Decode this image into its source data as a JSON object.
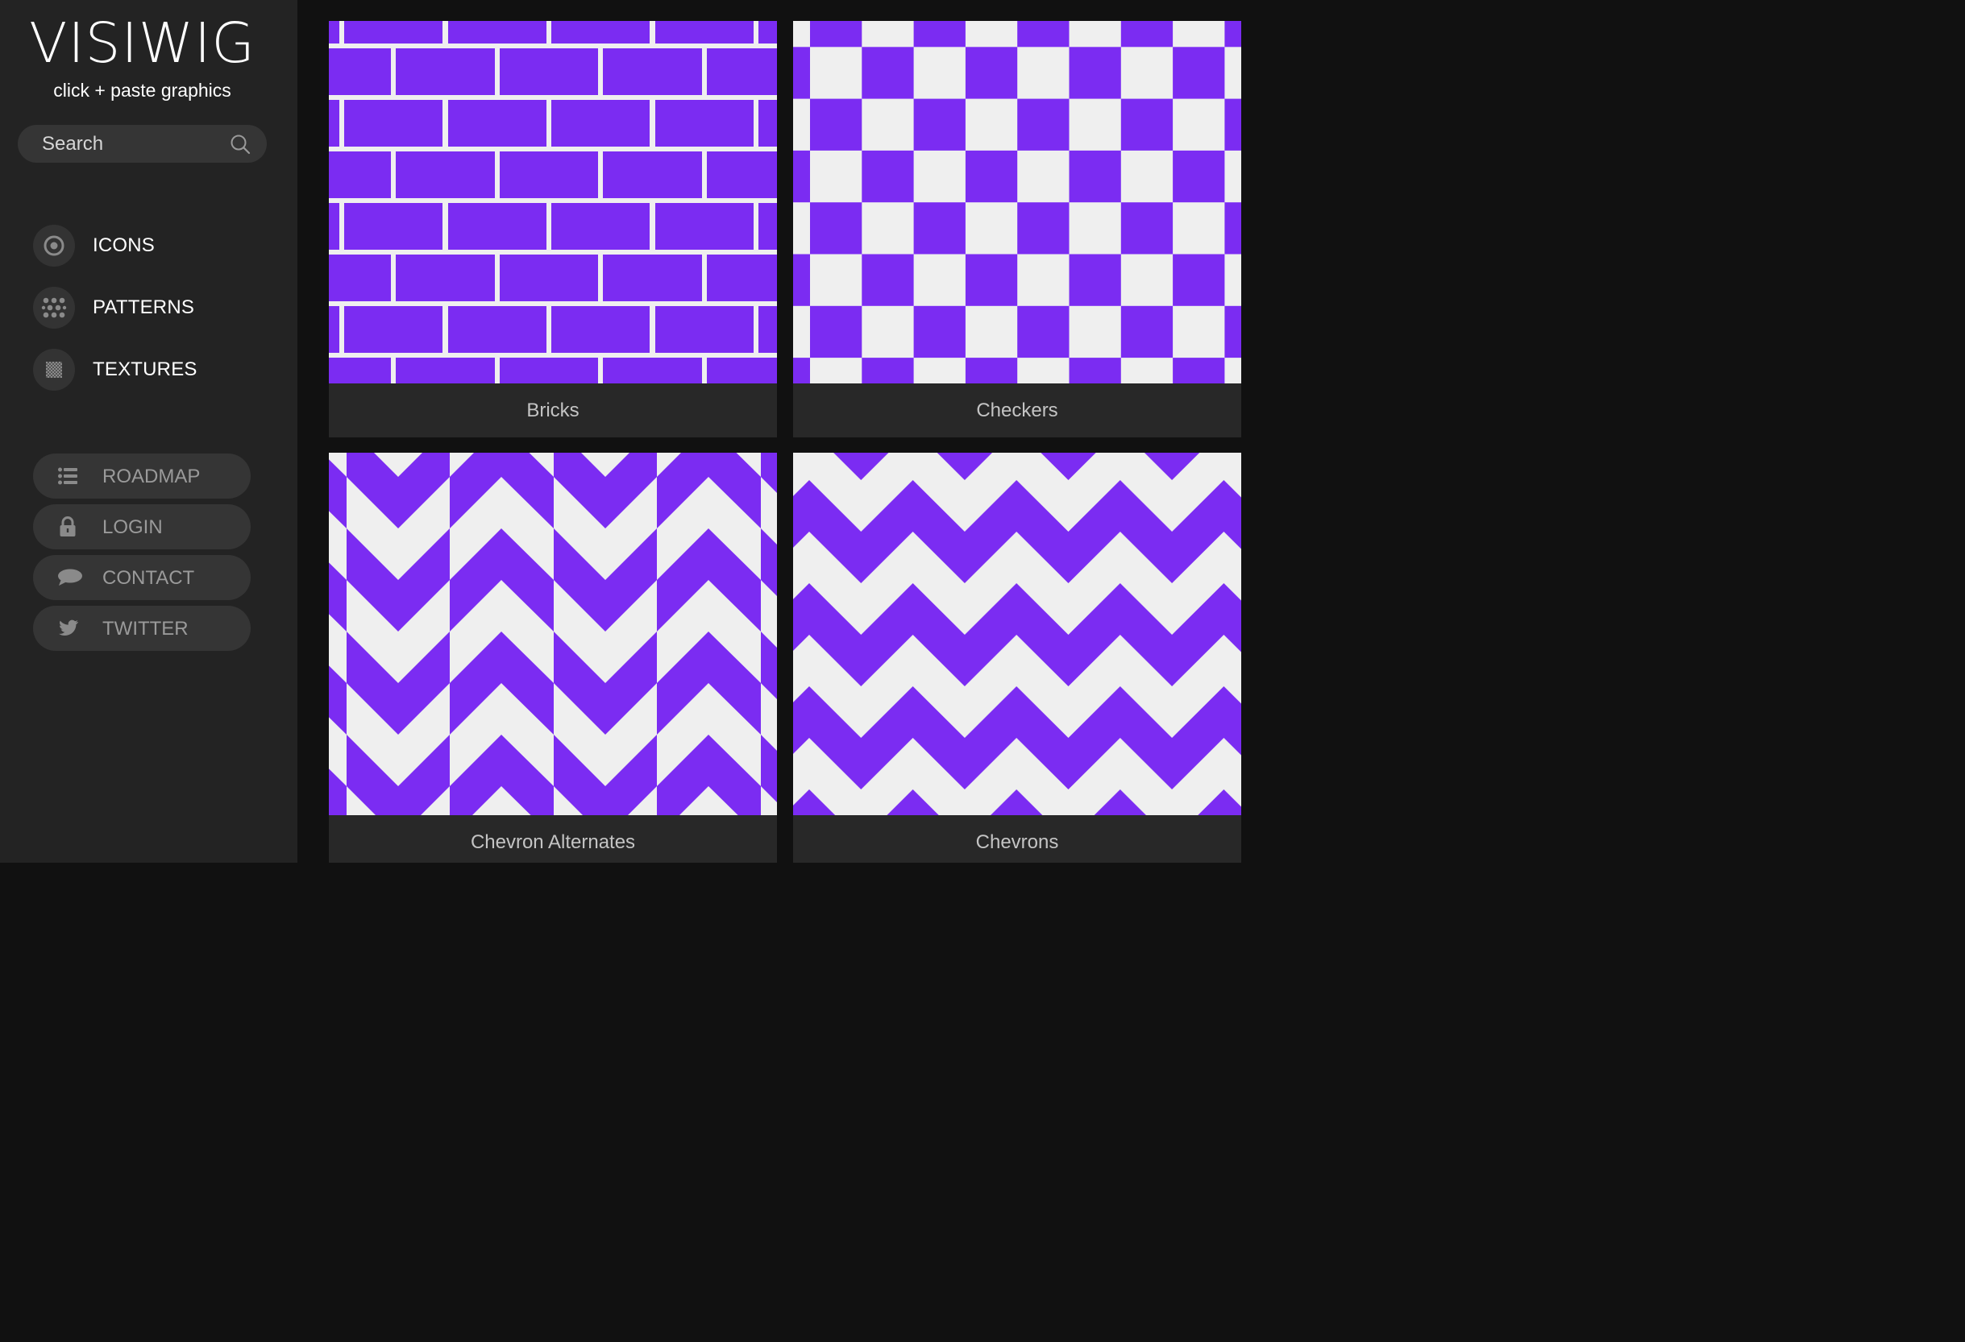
{
  "brand": {
    "title": "VISIWIG",
    "tagline": "click + paste graphics"
  },
  "search": {
    "placeholder": "Search"
  },
  "colors": {
    "accent": "#7B2CF2",
    "light": "#EFEFEF",
    "sidebar": "#232323",
    "background": "#111111"
  },
  "nav": {
    "items": [
      {
        "label": "ICONS",
        "icon": "target-icon"
      },
      {
        "label": "PATTERNS",
        "icon": "dots-grid-icon"
      },
      {
        "label": "TEXTURES",
        "icon": "texture-icon"
      }
    ]
  },
  "links": {
    "items": [
      {
        "label": "ROADMAP",
        "icon": "list-icon"
      },
      {
        "label": "LOGIN",
        "icon": "lock-icon"
      },
      {
        "label": "CONTACT",
        "icon": "speech-bubble-icon"
      },
      {
        "label": "TWITTER",
        "icon": "twitter-bird-icon"
      }
    ]
  },
  "patterns": {
    "items": [
      {
        "name": "Bricks"
      },
      {
        "name": "Checkers"
      },
      {
        "name": "Chevron Alternates"
      },
      {
        "name": "Chevrons"
      }
    ]
  }
}
